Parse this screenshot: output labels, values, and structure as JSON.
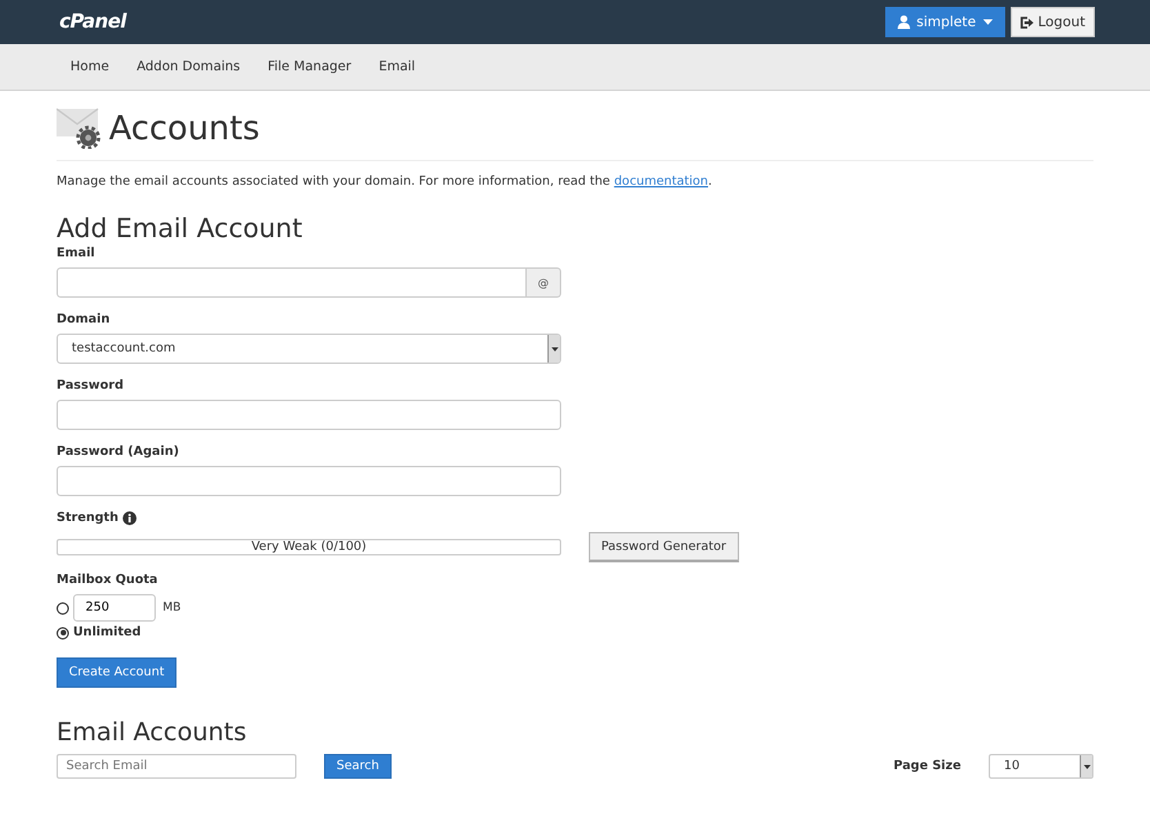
{
  "header": {
    "logo": "cPanel",
    "user_menu": "simplete",
    "logout": "Logout"
  },
  "nav": [
    {
      "label": "Home"
    },
    {
      "label": "Addon Domains"
    },
    {
      "label": "File Manager"
    },
    {
      "label": "Email"
    }
  ],
  "page": {
    "title": "Accounts",
    "intro": "Manage the email accounts associated with your domain. For more information, read the ",
    "intro_link": "documentation",
    "intro_end": "."
  },
  "add_form": {
    "heading": "Add Email Account",
    "email": {
      "label": "Email",
      "addon": "@"
    },
    "domain": {
      "label": "Domain",
      "value": "testaccount.com"
    },
    "password": {
      "label": "Password"
    },
    "password_again": {
      "label": "Password (Again)"
    },
    "strength": {
      "label": "Strength",
      "level": 0,
      "reading": "Very Weak (0/100)",
      "generator": "Password Generator"
    },
    "quota": {
      "label": "Mailbox Quota",
      "options": [
        {
          "kind": "amount",
          "value": "250",
          "unit": "MB",
          "selected": false
        },
        {
          "kind": "text",
          "label": "Unlimited",
          "selected": true
        }
      ]
    },
    "submit": "Create Account"
  },
  "accounts": {
    "heading": "Email Accounts",
    "search_placeholder": "Search Email",
    "search_button": "Search",
    "page_size_label": "Page Size",
    "page_size": "10"
  }
}
